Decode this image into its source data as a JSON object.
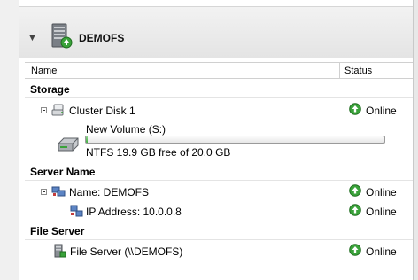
{
  "group": {
    "title": "DEMOFS"
  },
  "columns": {
    "name": "Name",
    "status": "Status"
  },
  "sections": {
    "storage": "Storage",
    "server_name": "Server Name",
    "file_server": "File Server"
  },
  "storage": {
    "disk": {
      "label": "Cluster Disk 1",
      "status": "Online"
    },
    "volume": {
      "name": "New Volume (S:)",
      "detail": "NTFS 19.9 GB free of 20.0 GB",
      "used_fraction": 0.005
    }
  },
  "server_name": {
    "name": {
      "label": "Name: DEMOFS",
      "status": "Online"
    },
    "ip": {
      "label": "IP Address: 10.0.0.8",
      "status": "Online"
    }
  },
  "file_server": {
    "item": {
      "label": "File Server (\\\\DEMOFS)",
      "status": "Online"
    }
  },
  "colors": {
    "online_green": "#3aa23a",
    "section_line": "#e4e4e4",
    "header_band": "#e8e8e8"
  }
}
